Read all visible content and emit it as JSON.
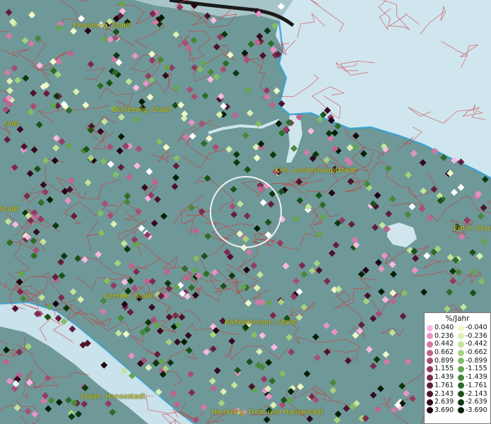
{
  "map": {
    "cities": [
      {
        "name": "Flensburg, Stadt"
      },
      {
        "name": "Schleswig, Stadt"
      },
      {
        "name": "Kiel, Landeshauptstadt"
      },
      {
        "name": "Stadt"
      },
      {
        "name": "Stadt"
      },
      {
        "name": "Eutin, Stadt"
      },
      {
        "name": "Itzehoe, Stadt"
      },
      {
        "name": "Kaltenkirchen, Stadt"
      },
      {
        "name": "Stade, Hansestadt"
      },
      {
        "name": "Hamburg, Freie und Hansestadt"
      }
    ],
    "colors": {
      "water": "#cfe6ef",
      "land": "#6f9898",
      "boundaries": "#d63030",
      "label": "#d8c500"
    }
  },
  "legend": {
    "title": "%/Jahr",
    "positive": [
      {
        "label": "0.040",
        "color": "#f7b8e2"
      },
      {
        "label": "0.236",
        "color": "#e793c7"
      },
      {
        "label": "0.442",
        "color": "#d37aa8"
      },
      {
        "label": "0.662",
        "color": "#bf6390"
      },
      {
        "label": "0.899",
        "color": "#a84e77"
      },
      {
        "label": "1.155",
        "color": "#933b62"
      },
      {
        "label": "1.439",
        "color": "#7c2b4d"
      },
      {
        "label": "1.761",
        "color": "#641e3a"
      },
      {
        "label": "2.143",
        "color": "#4d1329"
      },
      {
        "label": "2.639",
        "color": "#350a1b"
      },
      {
        "label": "3.690",
        "color": "#200410"
      }
    ],
    "negative": [
      {
        "label": "-0.040",
        "color": "#f1f8c9"
      },
      {
        "label": "-0.236",
        "color": "#dcefb2"
      },
      {
        "label": "-0.442",
        "color": "#c3e39a"
      },
      {
        "label": "-0.662",
        "color": "#a6d27f"
      },
      {
        "label": "-0.899",
        "color": "#85bd66"
      },
      {
        "label": "-1.155",
        "color": "#64a54f"
      },
      {
        "label": "-1.439",
        "color": "#46893a"
      },
      {
        "label": "-1.761",
        "color": "#2d6d28"
      },
      {
        "label": "-2.143",
        "color": "#19521a"
      },
      {
        "label": "-2.639",
        "color": "#0c380f"
      },
      {
        "label": "-3.690",
        "color": "#041f06"
      }
    ]
  }
}
